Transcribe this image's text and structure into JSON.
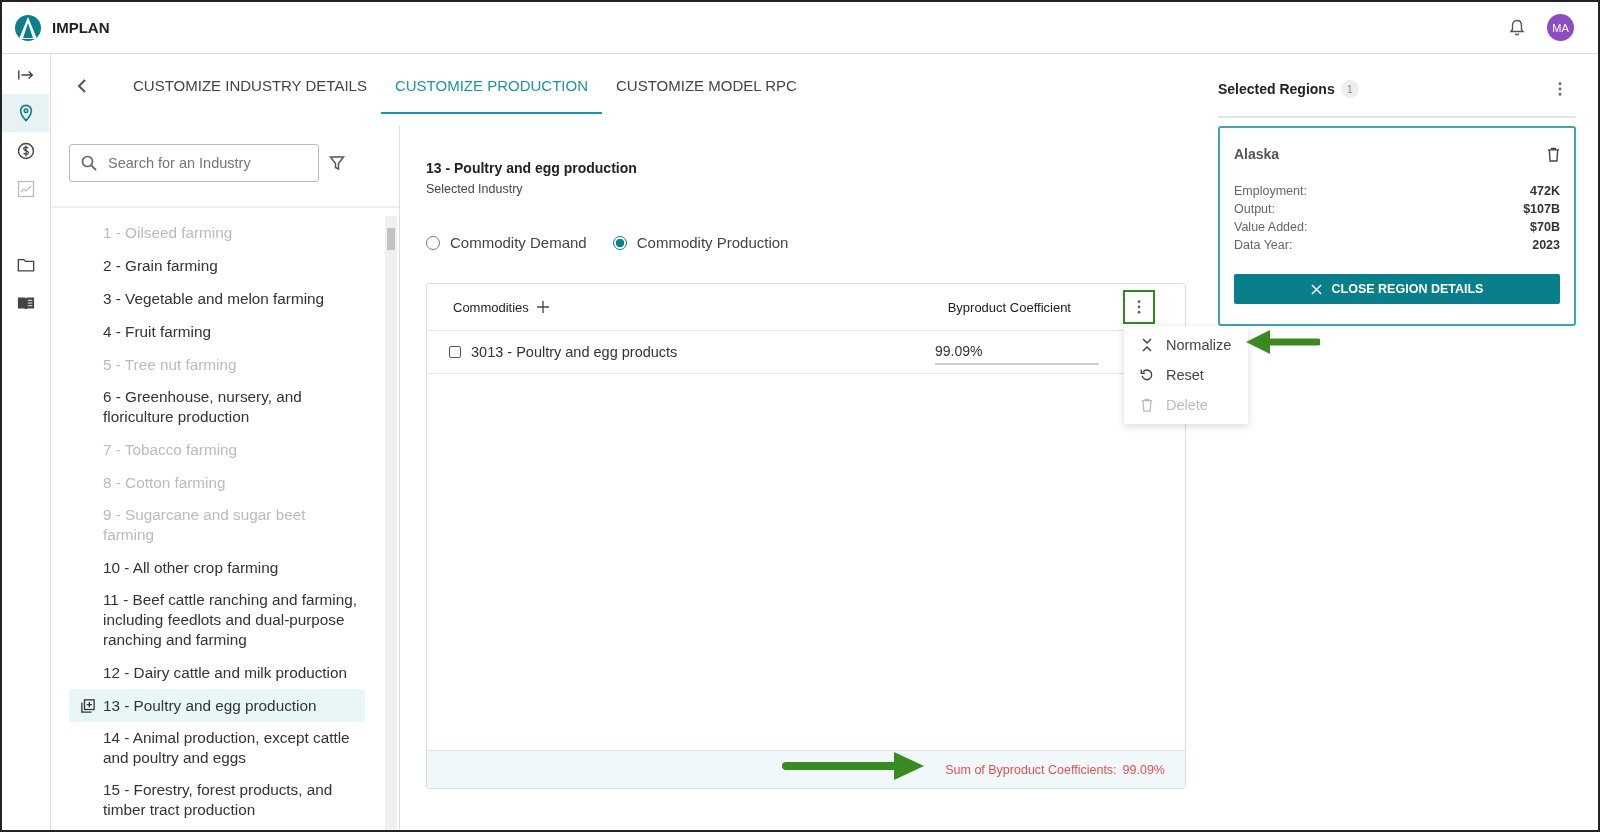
{
  "app": {
    "name": "IMPLAN",
    "avatar": "MA"
  },
  "rail": [
    {
      "kind": "collapse",
      "selected": false,
      "disabled": false
    },
    {
      "kind": "location",
      "selected": true,
      "disabled": false
    },
    {
      "kind": "money",
      "selected": false,
      "disabled": false
    },
    {
      "kind": "chart",
      "selected": false,
      "disabled": true
    },
    {
      "kind": "folder",
      "selected": false,
      "disabled": false
    },
    {
      "kind": "book",
      "selected": false,
      "disabled": false
    }
  ],
  "tabs": [
    {
      "label": "CUSTOMIZE INDUSTRY DETAILS",
      "selected": false
    },
    {
      "label": "CUSTOMIZE PRODUCTION",
      "selected": true
    },
    {
      "label": "CUSTOMIZE MODEL RPC",
      "selected": false
    }
  ],
  "search": {
    "placeholder": "Search for an Industry"
  },
  "industries": [
    {
      "label": "1 - Oilseed farming",
      "disabled": true,
      "selected": false
    },
    {
      "label": "2 - Grain farming",
      "disabled": false,
      "selected": false
    },
    {
      "label": "3 - Vegetable and melon farming",
      "disabled": false,
      "selected": false
    },
    {
      "label": "4 - Fruit farming",
      "disabled": false,
      "selected": false
    },
    {
      "label": "5 - Tree nut farming",
      "disabled": true,
      "selected": false
    },
    {
      "label": "6 - Greenhouse, nursery, and floriculture production",
      "disabled": false,
      "selected": false
    },
    {
      "label": "7 - Tobacco farming",
      "disabled": true,
      "selected": false
    },
    {
      "label": "8 - Cotton farming",
      "disabled": true,
      "selected": false
    },
    {
      "label": "9 - Sugarcane and sugar beet farming",
      "disabled": true,
      "selected": false
    },
    {
      "label": "10 - All other crop farming",
      "disabled": false,
      "selected": false
    },
    {
      "label": "11 - Beef cattle ranching and farming, including feedlots and dual-purpose ranching and farming",
      "disabled": false,
      "selected": false
    },
    {
      "label": "12 - Dairy cattle and milk production",
      "disabled": false,
      "selected": false
    },
    {
      "label": "13 - Poultry and egg production",
      "disabled": false,
      "selected": true
    },
    {
      "label": "14 - Animal production, except cattle and poultry and eggs",
      "disabled": false,
      "selected": false
    },
    {
      "label": "15 - Forestry, forest products, and timber tract production",
      "disabled": false,
      "selected": false
    }
  ],
  "selected_industry": {
    "title": "13 - Poultry and egg production",
    "subtitle": "Selected Industry"
  },
  "radios": [
    {
      "label": "Commodity Demand",
      "selected": false
    },
    {
      "label": "Commodity Production",
      "selected": true
    }
  ],
  "table": {
    "columns": [
      "Commodities",
      "Byproduct Coefficient"
    ],
    "rows": [
      {
        "name": "3013 - Poultry and egg products",
        "checked": false,
        "value": "99.09%"
      }
    ],
    "footer": {
      "label": "Sum of Byproduct Coefficients:",
      "value": "99.09%"
    }
  },
  "menu": [
    {
      "kind": "normalize",
      "label": "Normalize",
      "disabled": false
    },
    {
      "kind": "reset",
      "label": "Reset",
      "disabled": false
    },
    {
      "kind": "delete",
      "label": "Delete",
      "disabled": true
    }
  ],
  "regions": {
    "title": "Selected Regions",
    "count": "1",
    "card": {
      "name": "Alaska",
      "stats": [
        {
          "label": "Employment:",
          "value": "472K"
        },
        {
          "label": "Output:",
          "value": "$107B"
        },
        {
          "label": "Value Added:",
          "value": "$70B"
        },
        {
          "label": "Data Year:",
          "value": "2023"
        }
      ],
      "button": "CLOSE REGION DETAILS"
    }
  }
}
